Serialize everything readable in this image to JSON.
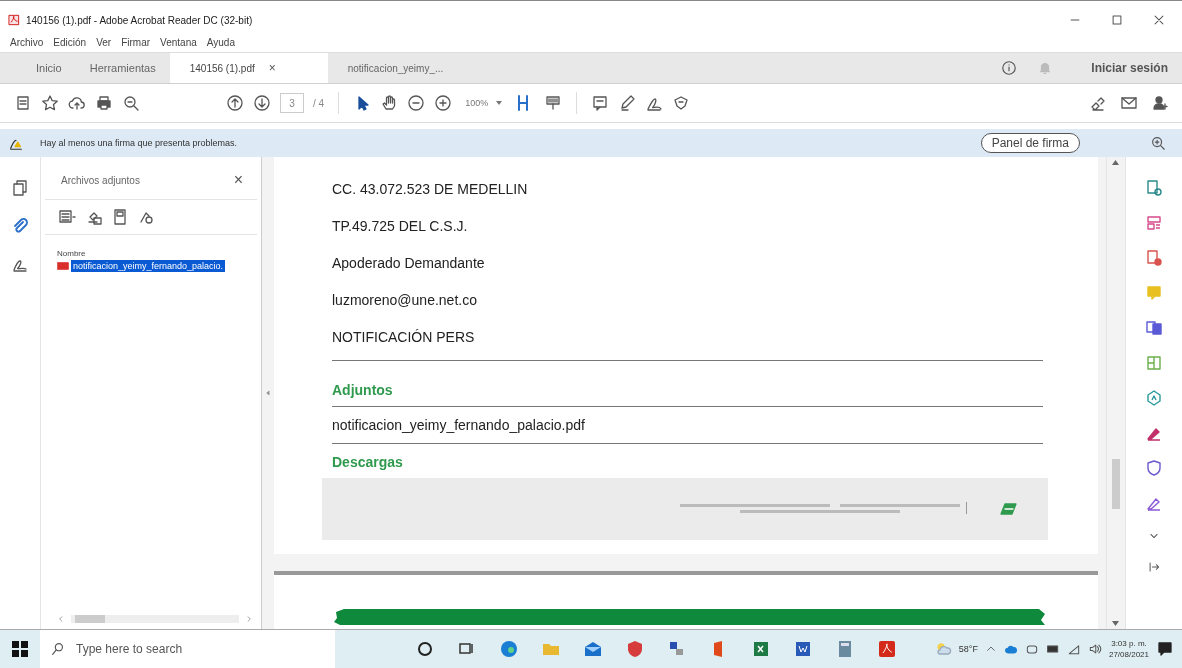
{
  "window": {
    "title": "140156 (1).pdf - Adobe Acrobat Reader DC (32-bit)"
  },
  "menu": [
    "Archivo",
    "Edición",
    "Ver",
    "Firmar",
    "Ventana",
    "Ayuda"
  ],
  "tabs": [
    {
      "label": "Inicio",
      "kind": "nav",
      "selected": false
    },
    {
      "label": "Herramientas",
      "kind": "nav",
      "selected": false
    },
    {
      "label": "140156 (1).pdf",
      "kind": "doc",
      "close": "×",
      "selected": true
    },
    {
      "label": "notificacion_yeimy_...",
      "kind": "doc",
      "selected": false
    }
  ],
  "sign_in": "Iniciar sesión",
  "toolbar": {
    "page": "3",
    "page_total": "/ 4",
    "zoom": "100%"
  },
  "notice": {
    "text": "Hay al menos una firma que presenta problemas.",
    "button": "Panel de firma"
  },
  "attachments": {
    "title": "Archivos adjuntos",
    "close": "×",
    "column": "Nombre",
    "files": [
      {
        "name": "notificacion_yeimy_fernando_palacio.",
        "selected": true
      }
    ]
  },
  "document": {
    "lines": [
      {
        "kind": "text",
        "text": "CC. 43.072.523 DE MEDELLIN"
      },
      {
        "kind": "text",
        "text": "TP.49.725 DEL C.S.J."
      },
      {
        "kind": "text",
        "text": "Apoderado Demandante"
      },
      {
        "kind": "text",
        "text": "luzmoreno@une.net.co"
      },
      {
        "kind": "text",
        "text": "NOTIFICACIÓN PERS"
      },
      {
        "kind": "rule"
      },
      {
        "kind": "heading",
        "text": "Adjuntos"
      },
      {
        "kind": "rule"
      },
      {
        "kind": "file",
        "text": "notificacion_yeimy_fernando_palacio.pdf"
      },
      {
        "kind": "rule"
      },
      {
        "kind": "heading",
        "text": "Descargas"
      }
    ]
  },
  "taskbar": {
    "search_placeholder": "Type here to search",
    "weather": "58°F",
    "time": "3:03 p. m.",
    "date": "27/08/2021"
  }
}
